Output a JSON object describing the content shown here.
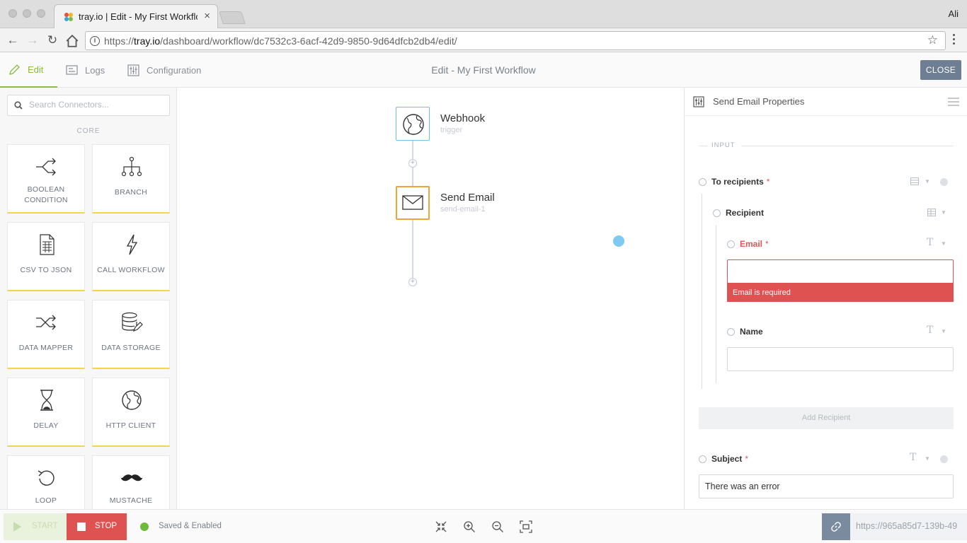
{
  "browser": {
    "tab_title": "tray.io | Edit - My First Workflow",
    "profile_name": "Ali",
    "url_prefix": "https://",
    "url_host": "tray.io",
    "url_path": "/dashboard/workflow/dc7532c3-6acf-42d9-9850-9d64dfcb2db4/edit/"
  },
  "header": {
    "nav": [
      {
        "label": "Edit",
        "icon": "pencil-icon",
        "active": true
      },
      {
        "label": "Logs",
        "icon": "logs-icon",
        "active": false
      },
      {
        "label": "Configuration",
        "icon": "sliders-icon",
        "active": false
      }
    ],
    "title": "Edit - My First Workflow",
    "close_label": "CLOSE"
  },
  "sidebar": {
    "search_placeholder": "Search Connectors...",
    "section_label": "CORE",
    "connectors": [
      {
        "label": "BOOLEAN CONDITION",
        "icon": "boolean-condition-icon"
      },
      {
        "label": "BRANCH",
        "icon": "branch-icon"
      },
      {
        "label": "CSV TO JSON",
        "icon": "csv-to-json-icon"
      },
      {
        "label": "CALL WORKFLOW",
        "icon": "call-workflow-icon"
      },
      {
        "label": "DATA MAPPER",
        "icon": "data-mapper-icon"
      },
      {
        "label": "DATA STORAGE",
        "icon": "data-storage-icon"
      },
      {
        "label": "DELAY",
        "icon": "delay-icon"
      },
      {
        "label": "HTTP CLIENT",
        "icon": "http-client-icon"
      },
      {
        "label": "LOOP",
        "icon": "loop-icon"
      },
      {
        "label": "MUSTACHE",
        "icon": "mustache-icon"
      }
    ],
    "accent": "#f2d647"
  },
  "canvas": {
    "nodes": [
      {
        "title": "Webhook",
        "subtitle": "trigger",
        "icon": "globe-icon",
        "border": "#6cc1e6"
      },
      {
        "title": "Send Email",
        "subtitle": "send-email-1",
        "icon": "envelope-icon",
        "border": "#f0a53a"
      }
    ]
  },
  "properties": {
    "title": "Send Email Properties",
    "section_label": "INPUT",
    "to_recipients_label": "To recipients",
    "recipient_label": "Recipient",
    "email_label": "Email",
    "email_value": "",
    "email_error": "Email is required",
    "name_label": "Name",
    "name_value": "",
    "add_recipient_label": "Add Recipient",
    "subject_label": "Subject",
    "subject_value": "There was an error",
    "required_mark": "*",
    "error_color": "#df5252"
  },
  "bottom": {
    "start_label": "START",
    "stop_label": "STOP",
    "status_text": "Saved & Enabled",
    "status_color": "#6fbb3c",
    "webhook_url": "https://965a85d7-139b-49"
  }
}
